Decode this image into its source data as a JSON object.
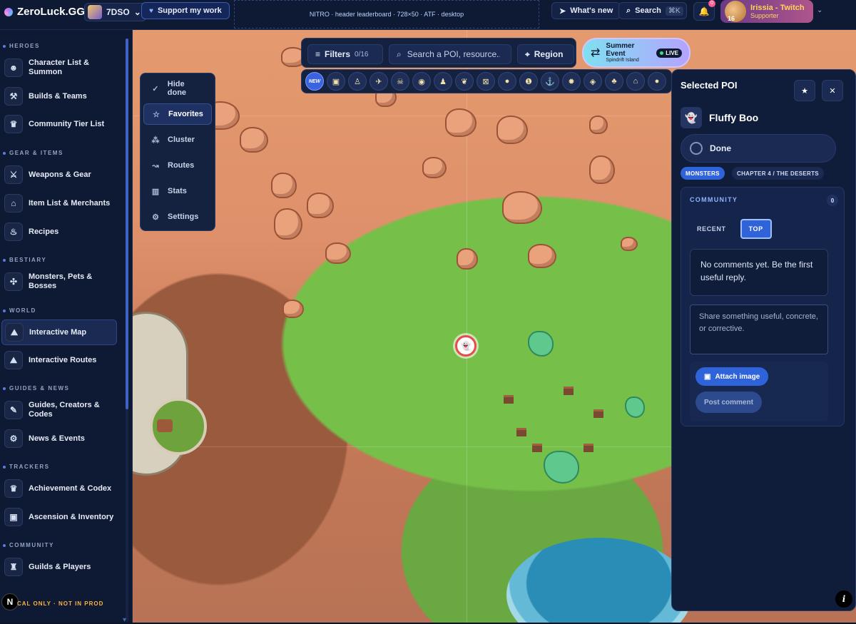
{
  "header": {
    "logo": "ZeroLuck.GG",
    "game": "7DSO",
    "support": "Support my work",
    "ad": "NITRO · header leaderboard · 728×50 · ATF · desktop",
    "whats_new": "What's new",
    "search": "Search",
    "search_kbd": "⌘K",
    "notif_count": "0",
    "user_name": "Irissia - Twitch",
    "user_role": "Supporter",
    "user_level": "16"
  },
  "sidebar": {
    "sections": [
      "HEROES",
      "GEAR & ITEMS",
      "BESTIARY",
      "WORLD",
      "GUIDES & NEWS",
      "TRACKERS",
      "COMMUNITY"
    ],
    "items": [
      {
        "label": "Character List & Summon"
      },
      {
        "label": "Builds & Teams"
      },
      {
        "label": "Community Tier List"
      },
      {
        "label": "Weapons & Gear"
      },
      {
        "label": "Item List & Merchants"
      },
      {
        "label": "Recipes"
      },
      {
        "label": "Monsters, Pets & Bosses"
      },
      {
        "label": "Interactive Map"
      },
      {
        "label": "Interactive Routes"
      },
      {
        "label": "Guides, Creators & Codes"
      },
      {
        "label": "News & Events"
      },
      {
        "label": "Achievement & Codex"
      },
      {
        "label": "Ascension & Inventory"
      },
      {
        "label": "Guilds & Players"
      }
    ],
    "active_item": "Interactive Map",
    "local_only": "CAL ONLY · NOT IN PROD",
    "n_badge": "N"
  },
  "map_toolbar": {
    "filters": "Filters",
    "filters_count": "0/16",
    "search_placeholder": "Search a POI, resource...",
    "region": "Region",
    "new_badge": "NEW"
  },
  "event": {
    "title": "Summer Event",
    "subtitle": "Spindrift Island",
    "live": "LIVE"
  },
  "menu": {
    "items": [
      "Hide done",
      "Favorites",
      "Cluster",
      "Routes",
      "Stats",
      "Settings"
    ],
    "active": "Favorites"
  },
  "panel": {
    "title": "Selected POI",
    "poi_name": "Fluffy Boo",
    "done": "Done",
    "tags": [
      "MONSTERS",
      "CHAPTER 4 / THE DESERTS"
    ],
    "community": {
      "title": "COMMUNITY",
      "count": "0",
      "tabs": [
        "RECENT",
        "TOP"
      ],
      "active_tab": "TOP",
      "empty": "No comments yet. Be the first useful reply.",
      "placeholder": "Share something useful, concrete, or corrective.",
      "attach": "Attach image",
      "post": "Post comment"
    },
    "info": "i"
  }
}
